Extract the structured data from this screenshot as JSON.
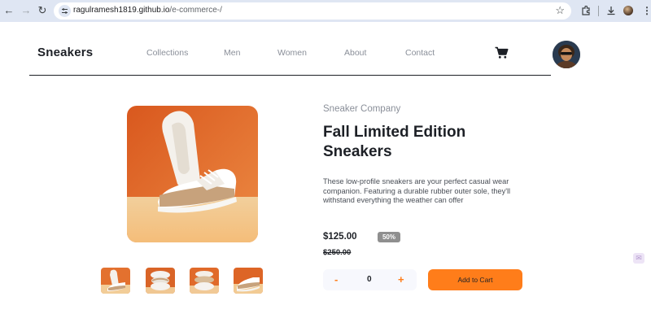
{
  "browser": {
    "url_host": "ragulramesh1819.github.io",
    "url_path": "/e-commerce-/",
    "icons": [
      "back-arrow",
      "forward-arrow",
      "reload",
      "site-settings",
      "bookmark-star",
      "extensions",
      "download",
      "profile",
      "menu-dots"
    ]
  },
  "header": {
    "logo": "Sneakers",
    "nav": [
      "Collections",
      "Men",
      "Women",
      "About",
      "Contact"
    ]
  },
  "product": {
    "company": "Sneaker Company",
    "title": "Fall Limited Edition Sneakers",
    "description": "These low-profile sneakers are your perfect casual wear companion. Featuring a durable rubber outer sole, they'll withstand everything the weather can offer",
    "price": "$125.00",
    "discount": "50%",
    "original_price": "$250.00",
    "quantity": "0",
    "minus_label": "-",
    "plus_label": "+",
    "add_to_cart_label": "Add to Cart"
  },
  "colors": {
    "accent": "#ff7d1a",
    "text_dark": "#1d2026",
    "text_muted": "#8a8f99",
    "qty_bg": "#f7f8fd",
    "image_orange": "#e46c2d",
    "image_sand": "#efc793"
  }
}
